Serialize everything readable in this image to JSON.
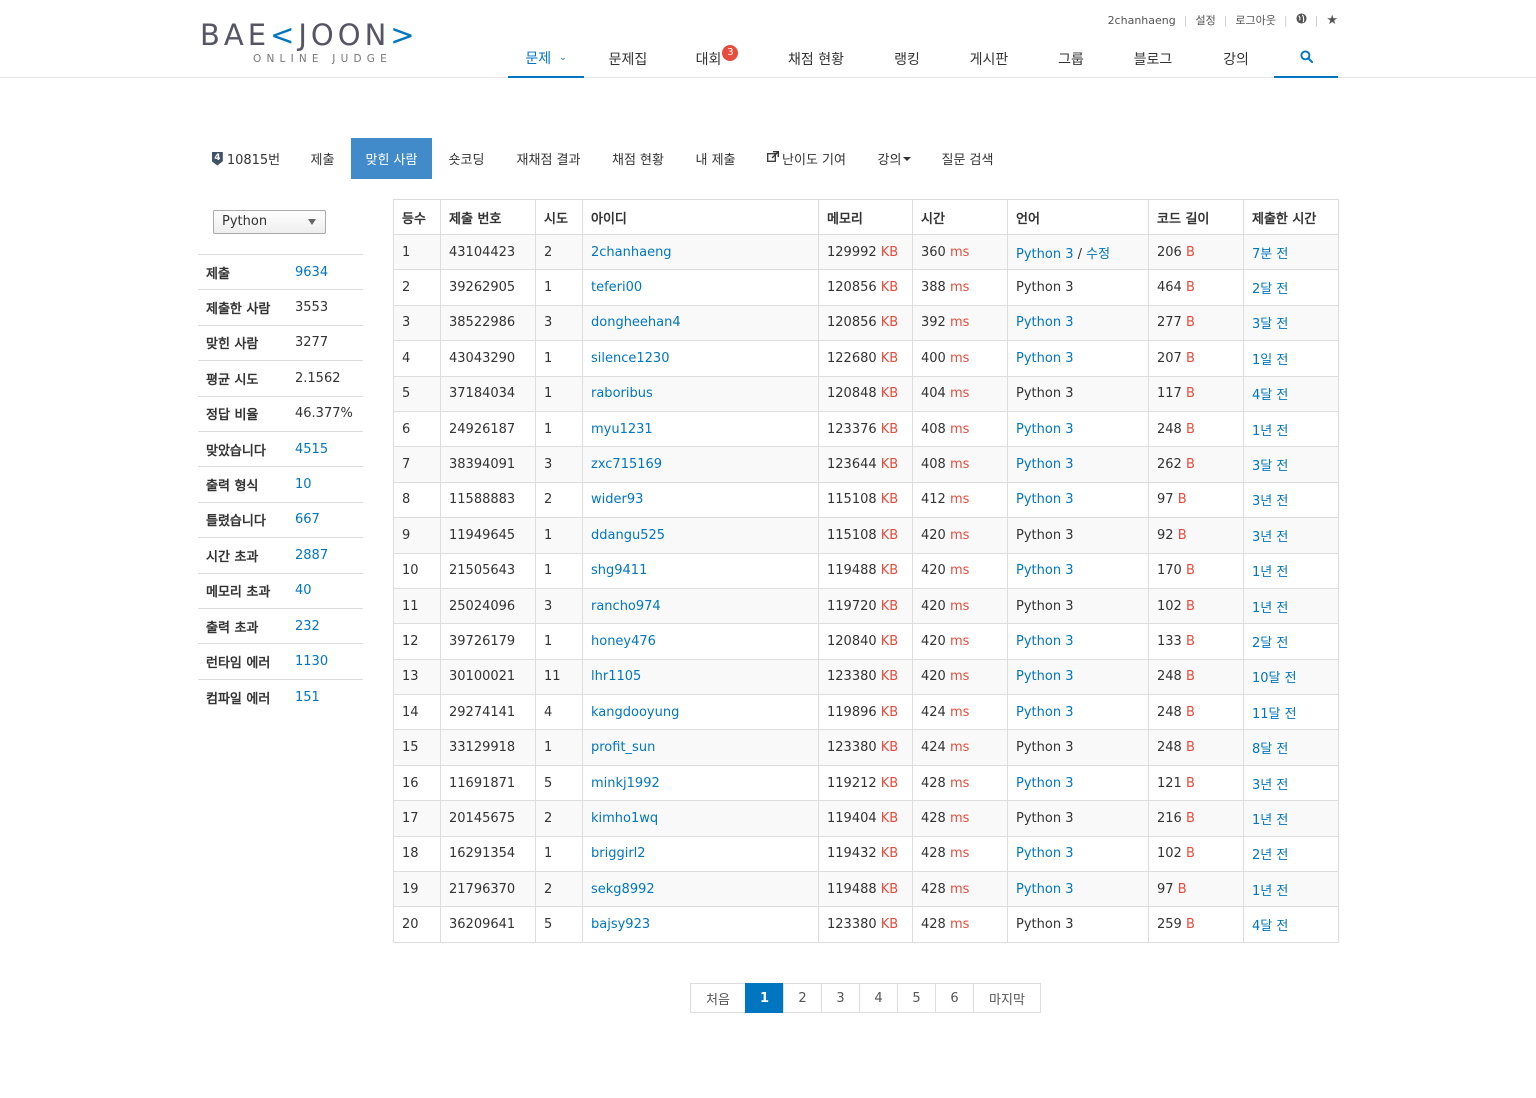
{
  "brand": {
    "logo_main_a": "BAE",
    "logo_bracket_l": "<",
    "logo_main_b": "JOON",
    "logo_bracket_r": ">",
    "logo_sub": "ONLINE JUDGE",
    "accent": "#0076c0"
  },
  "topbar": {
    "user": "2chanhaeng",
    "settings": "설정",
    "logout": "로그아웃",
    "globe_icon": "globe-icon",
    "star_icon": "star-icon"
  },
  "nav": {
    "items": [
      {
        "label": "문제",
        "active": true
      },
      {
        "label": "문제집"
      },
      {
        "label": "대회",
        "badge": "3"
      },
      {
        "label": "채점 현황"
      },
      {
        "label": "랭킹"
      },
      {
        "label": "게시판"
      },
      {
        "label": "그룹"
      },
      {
        "label": "블로그"
      },
      {
        "label": "강의"
      }
    ],
    "search_icon": "search-icon"
  },
  "subtabs": {
    "problem_badge": "4",
    "problem": "10815번",
    "submit": "제출",
    "solvers": "맞힌 사람",
    "shortcoding": "숏코딩",
    "rejudge": "재채점 결과",
    "status": "채점 현황",
    "my_submit": "내 제출",
    "difficulty": "난이도 기여",
    "lecture": "강의",
    "qna": "질문 검색"
  },
  "sidebar": {
    "language": "Python",
    "stats": [
      {
        "key": "제출",
        "value": "9634",
        "link": true
      },
      {
        "key": "제출한 사람",
        "value": "3553",
        "link": false
      },
      {
        "key": "맞힌 사람",
        "value": "3277",
        "link": false
      },
      {
        "key": "평균 시도",
        "value": "2.1562",
        "link": false
      },
      {
        "key": "정답 비율",
        "value": "46.377%",
        "link": false
      },
      {
        "key": "맞았습니다",
        "value": "4515",
        "link": true
      },
      {
        "key": "출력 형식",
        "value": "10",
        "link": true
      },
      {
        "key": "틀렸습니다",
        "value": "667",
        "link": true
      },
      {
        "key": "시간 초과",
        "value": "2887",
        "link": true
      },
      {
        "key": "메모리 초과",
        "value": "40",
        "link": true
      },
      {
        "key": "출력 초과",
        "value": "232",
        "link": true
      },
      {
        "key": "런타임 에러",
        "value": "1130",
        "link": true
      },
      {
        "key": "컴파일 에러",
        "value": "151",
        "link": true
      }
    ]
  },
  "table": {
    "headers": [
      "등수",
      "제출 번호",
      "시도",
      "아이디",
      "메모리",
      "시간",
      "언어",
      "코드 길이",
      "제출한 시간"
    ],
    "units": {
      "mem": "KB",
      "time": "ms",
      "len": "B"
    },
    "edit_sep": "/",
    "edit_label": "수정",
    "rows": [
      {
        "rank": "1",
        "sub": "43104423",
        "tries": "2",
        "id": "2chanhaeng",
        "mem": "129992",
        "time": "360",
        "lang": "Python 3",
        "lang_link": true,
        "edit": true,
        "len": "206",
        "when": "7분 전"
      },
      {
        "rank": "2",
        "sub": "39262905",
        "tries": "1",
        "id": "teferi00",
        "mem": "120856",
        "time": "388",
        "lang": "Python 3",
        "lang_link": false,
        "edit": false,
        "len": "464",
        "when": "2달 전"
      },
      {
        "rank": "3",
        "sub": "38522986",
        "tries": "3",
        "id": "dongheehan4",
        "mem": "120856",
        "time": "392",
        "lang": "Python 3",
        "lang_link": true,
        "edit": false,
        "len": "277",
        "when": "3달 전"
      },
      {
        "rank": "4",
        "sub": "43043290",
        "tries": "1",
        "id": "silence1230",
        "mem": "122680",
        "time": "400",
        "lang": "Python 3",
        "lang_link": true,
        "edit": false,
        "len": "207",
        "when": "1일 전"
      },
      {
        "rank": "5",
        "sub": "37184034",
        "tries": "1",
        "id": "raboribus",
        "mem": "120848",
        "time": "404",
        "lang": "Python 3",
        "lang_link": false,
        "edit": false,
        "len": "117",
        "when": "4달 전"
      },
      {
        "rank": "6",
        "sub": "24926187",
        "tries": "1",
        "id": "myu1231",
        "mem": "123376",
        "time": "408",
        "lang": "Python 3",
        "lang_link": true,
        "edit": false,
        "len": "248",
        "when": "1년 전"
      },
      {
        "rank": "7",
        "sub": "38394091",
        "tries": "3",
        "id": "zxc715169",
        "mem": "123644",
        "time": "408",
        "lang": "Python 3",
        "lang_link": true,
        "edit": false,
        "len": "262",
        "when": "3달 전"
      },
      {
        "rank": "8",
        "sub": "11588883",
        "tries": "2",
        "id": "wider93",
        "mem": "115108",
        "time": "412",
        "lang": "Python 3",
        "lang_link": true,
        "edit": false,
        "len": "97",
        "when": "3년 전"
      },
      {
        "rank": "9",
        "sub": "11949645",
        "tries": "1",
        "id": "ddangu525",
        "mem": "115108",
        "time": "420",
        "lang": "Python 3",
        "lang_link": false,
        "edit": false,
        "len": "92",
        "when": "3년 전"
      },
      {
        "rank": "10",
        "sub": "21505643",
        "tries": "1",
        "id": "shg9411",
        "mem": "119488",
        "time": "420",
        "lang": "Python 3",
        "lang_link": true,
        "edit": false,
        "len": "170",
        "when": "1년 전"
      },
      {
        "rank": "11",
        "sub": "25024096",
        "tries": "3",
        "id": "rancho974",
        "mem": "119720",
        "time": "420",
        "lang": "Python 3",
        "lang_link": false,
        "edit": false,
        "len": "102",
        "when": "1년 전"
      },
      {
        "rank": "12",
        "sub": "39726179",
        "tries": "1",
        "id": "honey476",
        "mem": "120840",
        "time": "420",
        "lang": "Python 3",
        "lang_link": true,
        "edit": false,
        "len": "133",
        "when": "2달 전"
      },
      {
        "rank": "13",
        "sub": "30100021",
        "tries": "11",
        "id": "lhr1105",
        "mem": "123380",
        "time": "420",
        "lang": "Python 3",
        "lang_link": true,
        "edit": false,
        "len": "248",
        "when": "10달 전"
      },
      {
        "rank": "14",
        "sub": "29274141",
        "tries": "4",
        "id": "kangdooyung",
        "mem": "119896",
        "time": "424",
        "lang": "Python 3",
        "lang_link": true,
        "edit": false,
        "len": "248",
        "when": "11달 전"
      },
      {
        "rank": "15",
        "sub": "33129918",
        "tries": "1",
        "id": "profit_sun",
        "mem": "123380",
        "time": "424",
        "lang": "Python 3",
        "lang_link": false,
        "edit": false,
        "len": "248",
        "when": "8달 전"
      },
      {
        "rank": "16",
        "sub": "11691871",
        "tries": "5",
        "id": "minkj1992",
        "mem": "119212",
        "time": "428",
        "lang": "Python 3",
        "lang_link": true,
        "edit": false,
        "len": "121",
        "when": "3년 전"
      },
      {
        "rank": "17",
        "sub": "20145675",
        "tries": "2",
        "id": "kimho1wq",
        "mem": "119404",
        "time": "428",
        "lang": "Python 3",
        "lang_link": false,
        "edit": false,
        "len": "216",
        "when": "1년 전"
      },
      {
        "rank": "18",
        "sub": "16291354",
        "tries": "1",
        "id": "briggirl2",
        "mem": "119432",
        "time": "428",
        "lang": "Python 3",
        "lang_link": true,
        "edit": false,
        "len": "102",
        "when": "2년 전"
      },
      {
        "rank": "19",
        "sub": "21796370",
        "tries": "2",
        "id": "sekg8992",
        "mem": "119488",
        "time": "428",
        "lang": "Python 3",
        "lang_link": true,
        "edit": false,
        "len": "97",
        "when": "1년 전"
      },
      {
        "rank": "20",
        "sub": "36209641",
        "tries": "5",
        "id": "bajsy923",
        "mem": "123380",
        "time": "428",
        "lang": "Python 3",
        "lang_link": false,
        "edit": false,
        "len": "259",
        "when": "4달 전"
      }
    ]
  },
  "pagination": {
    "first": "처음",
    "pages": [
      "1",
      "2",
      "3",
      "4",
      "5",
      "6"
    ],
    "current": "1",
    "last": "마지막"
  }
}
